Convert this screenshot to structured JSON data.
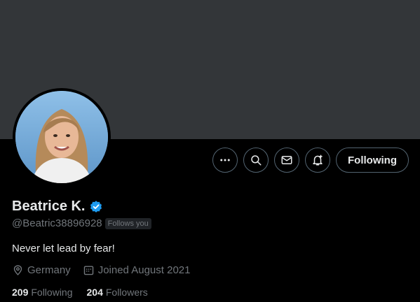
{
  "profile": {
    "name": "Beatrice K.",
    "handle": "@Beatric38896928",
    "follows_you_label": "Follows you",
    "bio": "Never let lead by fear!",
    "location": "Germany",
    "joined": "Joined August 2021",
    "verified": true
  },
  "stats": {
    "following_count": "209",
    "following_label": "Following",
    "followers_count": "204",
    "followers_label": "Followers"
  },
  "actions": {
    "follow_button_label": "Following",
    "icons": [
      "more-icon",
      "search-icon",
      "message-icon",
      "notification-bell-icon"
    ]
  },
  "colors": {
    "background": "#000000",
    "banner": "#333639",
    "verified": "#1d9bf0",
    "secondary_text": "#71767b",
    "primary_text": "#e7e9ea"
  }
}
